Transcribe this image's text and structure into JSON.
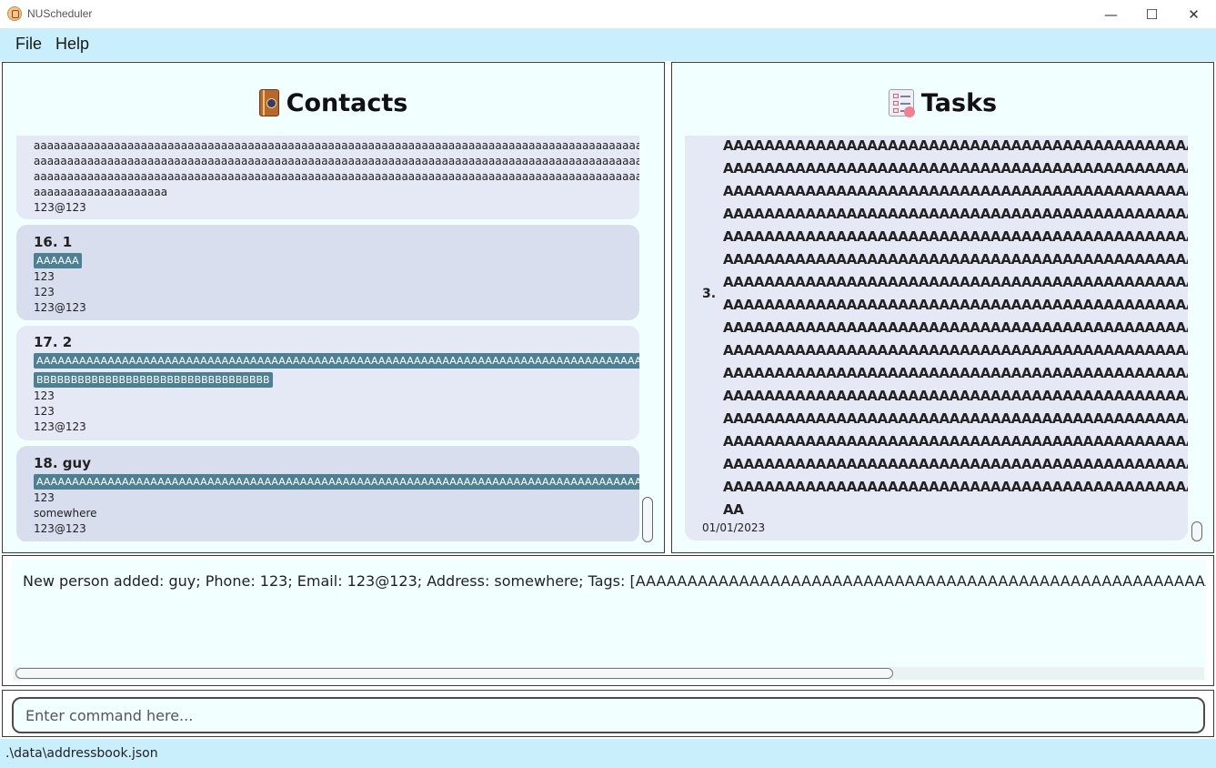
{
  "window": {
    "title": "NUScheduler",
    "controls": {
      "minimize": "—",
      "maximize": "☐",
      "close": "✕"
    }
  },
  "menu": {
    "items": [
      "File",
      "Help"
    ]
  },
  "contacts": {
    "title": "Contacts",
    "partial_card": {
      "address_lines": [
        "aaaaaaaaaaaaaaaaaaaaaaaaaaaaaaaaaaaaaaaaaaaaaaaaaaaaaaaaaaaaaaaaaaaaaaaaaaaaaaaaaaaaaaaaaaaaa",
        "aaaaaaaaaaaaaaaaaaaaaaaaaaaaaaaaaaaaaaaaaaaaaaaaaaaaaaaaaaaaaaaaaaaaaaaaaaaaaaaaaaaaaaaaaaaaa",
        "aaaaaaaaaaaaaaaaaaaaaaaaaaaaaaaaaaaaaaaaaaaaaaaaaaaaaaaaaaaaaaaaaaaaaaaaaaaaaaaaaaaaaaaaaaaaa",
        "aaaaaaaaaaaaaaaaaaaa"
      ],
      "email": "123@123"
    },
    "cards": [
      {
        "index_name": "16.  1",
        "tags": [
          "AAAAAA"
        ],
        "phone": "123",
        "address": "123",
        "email": "123@123"
      },
      {
        "index_name": "17.  2",
        "tags": [
          "AAAAAAAAAAAAAAAAAAAAAAAAAAAAAAAAAAAAAAAAAAAAAAAAAAAAAAAAAAAAAAAAAAAAAAAAAAAAAAAAAAAAA",
          "BBBBBBBBBBBBBBBBBBBBBBBBBBBBBBBBBB"
        ],
        "phone": "123",
        "address": "123",
        "email": "123@123"
      },
      {
        "index_name": "18.  guy",
        "tags": [
          "AAAAAAAAAAAAAAAAAAAAAAAAAAAAAAAAAAAAAAAAAAAAAAAAAAAAAAAAAAAAAAAAAAAAAAAAAAAAAAAAAAAAA"
        ],
        "phone": "123",
        "address": "somewhere",
        "email": "123@123"
      }
    ]
  },
  "tasks": {
    "title": "Tasks",
    "card": {
      "index": "3.",
      "lines": [
        "AAAAAAAAAAAAAAAAAAAAAAAAAAAAAAAAAAAAAAAAAAAAAAAAAAAAA",
        "AAAAAAAAAAAAAAAAAAAAAAAAAAAAAAAAAAAAAAAAAAAAAAAAAAAAA",
        "AAAAAAAAAAAAAAAAAAAAAAAAAAAAAAAAAAAAAAAAAAAAAAAAAAAAA",
        "AAAAAAAAAAAAAAAAAAAAAAAAAAAAAAAAAAAAAAAAAAAAAAAAAAAAA",
        "AAAAAAAAAAAAAAAAAAAAAAAAAAAAAAAAAAAAAAAAAAAAAAAAAAAAA",
        "AAAAAAAAAAAAAAAAAAAAAAAAAAAAAAAAAAAAAAAAAAAAAAAAAAAAA",
        "AAAAAAAAAAAAAAAAAAAAAAAAAAAAAAAAAAAAAAAAAAAAAAAAAAAAA",
        "AAAAAAAAAAAAAAAAAAAAAAAAAAAAAAAAAAAAAAAAAAAAAAAAAAAAA",
        "AAAAAAAAAAAAAAAAAAAAAAAAAAAAAAAAAAAAAAAAAAAAAAAAAAAAA",
        "AAAAAAAAAAAAAAAAAAAAAAAAAAAAAAAAAAAAAAAAAAAAAAAAAAAAA",
        "AAAAAAAAAAAAAAAAAAAAAAAAAAAAAAAAAAAAAAAAAAAAAAAAAAAAA",
        "AAAAAAAAAAAAAAAAAAAAAAAAAAAAAAAAAAAAAAAAAAAAAAAAAAAAA",
        "AAAAAAAAAAAAAAAAAAAAAAAAAAAAAAAAAAAAAAAAAAAAAAAAAAAAA",
        "AAAAAAAAAAAAAAAAAAAAAAAAAAAAAAAAAAAAAAAAAAAAAAAAAAAAA",
        "AAAAAAAAAAAAAAAAAAAAAAAAAAAAAAAAAAAAAAAAAAAAAAAAAAAAA",
        "AAAAAAAAAAAAAAAAAAAAAAAAAAAAAAAAAAAAAAAAAAAAAAAAAAAAA",
        "AA"
      ],
      "date": "01/01/2023"
    }
  },
  "result": {
    "text": "New person added: guy; Phone: 123; Email: 123@123; Address: somewhere; Tags: [AAAAAAAAAAAAAAAAAAAAAAAAAAAAAAAAAAAAAAAAAAAAAAAAAAAAAAAAAAAAAAAAAAAA"
  },
  "command": {
    "placeholder": "Enter command here..."
  },
  "status": {
    "path": ".\\data\\addressbook.json"
  }
}
